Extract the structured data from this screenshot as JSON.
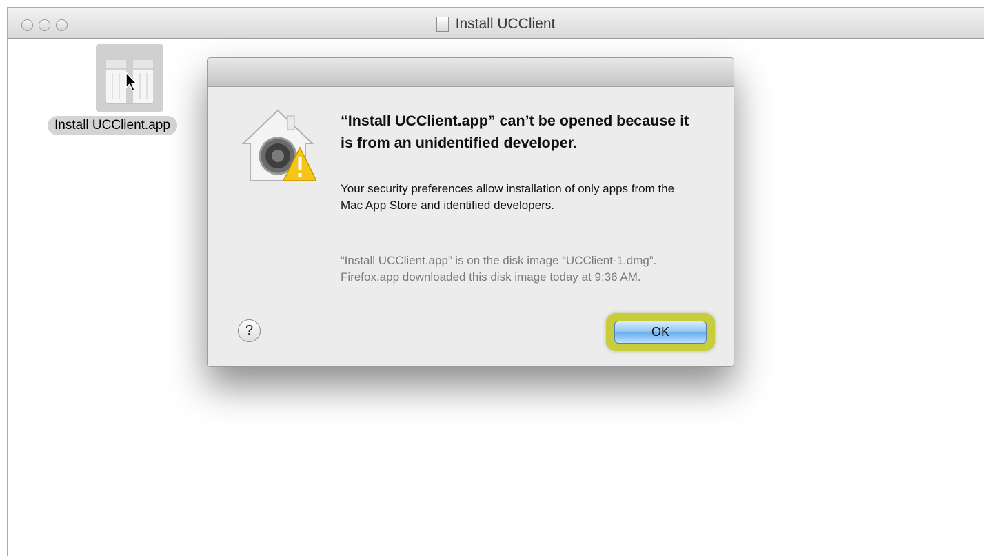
{
  "window": {
    "title": "Install UCClient"
  },
  "desktop": {
    "file_label": "Install UCClient.app"
  },
  "dialog": {
    "title": "“Install UCClient.app” can’t be opened because it is from an unidentified developer.",
    "body": "Your security preferences allow installation of only apps from the Mac App Store and identified developers.",
    "info": "“Install UCClient.app” is on the disk image “UCClient-1.dmg”. Firefox.app downloaded this disk image today at 9:36 AM.",
    "help_label": "?",
    "ok_label": "OK"
  },
  "icons": {
    "traffic_lights": [
      "close-icon",
      "minimize-icon",
      "zoom-icon"
    ],
    "gatekeeper": "gatekeeper-warning-icon",
    "file": "app-package-icon",
    "cursor": "mouse-cursor-icon"
  },
  "colors": {
    "ok_highlight": "#c8cd3c",
    "ok_button": "#8fc3ef",
    "warning": "#f5c518"
  }
}
